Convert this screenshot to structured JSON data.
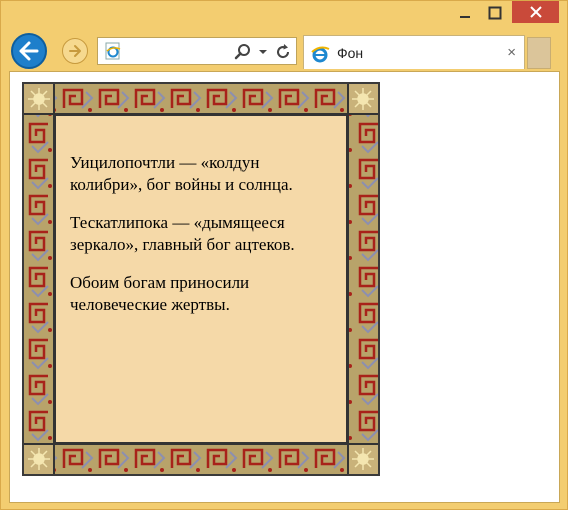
{
  "browser": {
    "tab_title": "Фон",
    "tab_close": "×",
    "caption": {
      "minimize": "—",
      "maximize": "☐",
      "close": "✕"
    }
  },
  "content": {
    "paragraphs": [
      "Уицилопочтли — «колдун колибри», бог войны и солнца.",
      "Тескатлипока — «дымящееся зеркало», главный бог ацтеков.",
      "Обоим богам приносили человеческие жертвы."
    ]
  },
  "colors": {
    "frame": "#f3cd70",
    "back_button": "#1e7fcb",
    "close_button": "#c94a3a",
    "inner_panel": "#f5d9a8",
    "border_pattern": "#b8a36a",
    "spiral_red": "#a8221a"
  },
  "icons": {
    "back": "arrow-left-icon",
    "forward": "arrow-right-icon",
    "page": "ie-page-icon",
    "search": "search-icon",
    "refresh": "refresh-icon",
    "tab_ie": "ie-logo-icon"
  }
}
